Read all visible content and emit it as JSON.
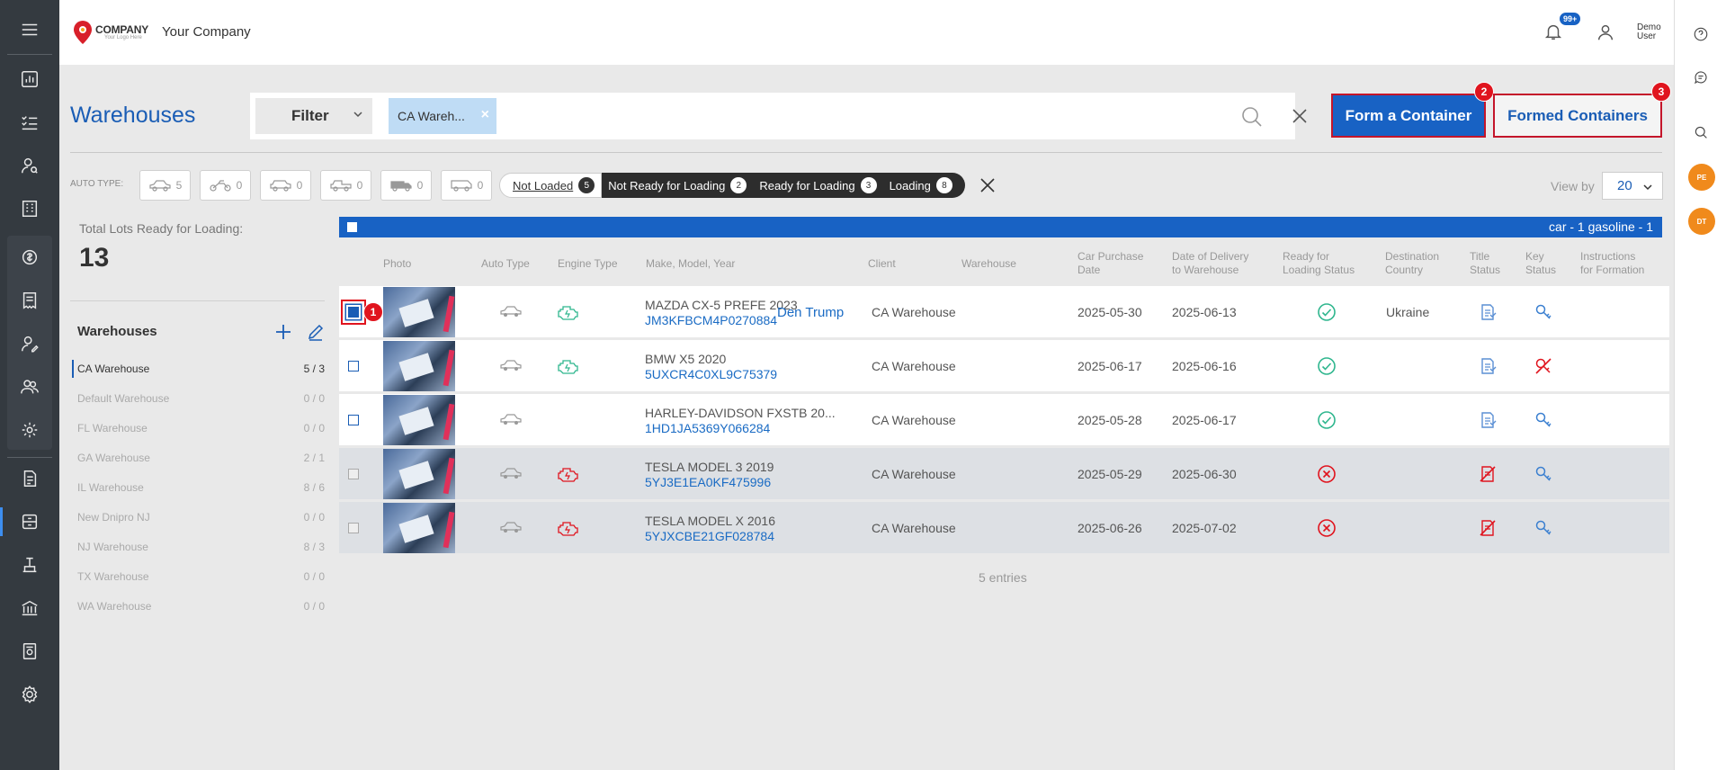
{
  "header": {
    "logo_text": "COMPANY",
    "logo_tagline": "Your Logo Here",
    "company_name": "Your Company",
    "notifications_badge": "99+",
    "user_first": "Demo",
    "user_last": "User"
  },
  "right_rail": {
    "avatars": [
      "PE",
      "DT"
    ]
  },
  "page": {
    "title": "Warehouses"
  },
  "filter": {
    "label": "Filter",
    "chip_label": "CA Wareh...",
    "chip_remove": "×"
  },
  "actions": {
    "form_container": "Form a Container",
    "form_container_badge": "2",
    "formed_containers": "Formed Containers",
    "formed_containers_badge": "3"
  },
  "auto_type": {
    "label": "AUTO TYPE:",
    "counts": [
      "5",
      "0",
      "0",
      "0",
      "0",
      "0"
    ]
  },
  "status_filters": [
    {
      "label": "Not Loaded",
      "count": "5"
    },
    {
      "label": "Not Ready for Loading",
      "count": "2"
    },
    {
      "label": "Ready for Loading",
      "count": "3"
    },
    {
      "label": "Loading",
      "count": "8"
    }
  ],
  "view_by": {
    "label": "View by",
    "value": "20"
  },
  "summary": {
    "total_label": "Total Lots Ready for Loading:",
    "total_value": "13"
  },
  "warehouses_panel": {
    "title": "Warehouses",
    "items": [
      {
        "name": "CA Warehouse",
        "count": "5 / 3",
        "active": true
      },
      {
        "name": "Default Warehouse",
        "count": "0 / 0"
      },
      {
        "name": "FL Warehouse",
        "count": "0 / 0"
      },
      {
        "name": "GA Warehouse",
        "count": "2 / 1"
      },
      {
        "name": "IL Warehouse",
        "count": "8 / 6"
      },
      {
        "name": "New Dnipro NJ",
        "count": "0 / 0"
      },
      {
        "name": "NJ Warehouse",
        "count": "8 / 3"
      },
      {
        "name": "TX Warehouse",
        "count": "0 / 0"
      },
      {
        "name": "WA Warehouse",
        "count": "0 / 0"
      }
    ]
  },
  "table": {
    "bar_summary": "car - 1 gasoline - 1",
    "headers": {
      "photo": "Photo",
      "auto_type": "Auto Type",
      "engine_type": "Engine Type",
      "make_model_year": "Make, Model, Year",
      "client": "Client",
      "warehouse": "Warehouse",
      "purchase_date_1": "Car Purchase",
      "purchase_date_2": "Date",
      "delivery_1": "Date of Delivery",
      "delivery_2": "to Warehouse",
      "ready_1": "Ready for",
      "ready_2": "Loading Status",
      "dest_1": "Destination",
      "dest_2": "Country",
      "title_1": "Title",
      "title_2": "Status",
      "key_1": "Key",
      "key_2": "Status",
      "instr_1": "Instructions",
      "instr_2": "for Formation"
    },
    "rows": [
      {
        "make": "MAZDA CX-5 PREFE 2023",
        "vin": "JM3KFBCM4P0270884",
        "client": "Den Trump",
        "warehouse": "CA Warehouse",
        "purchase": "2025-05-30",
        "delivery": "2025-06-13",
        "ready": true,
        "country": "Ukraine",
        "engine": "ok",
        "title_ok": true,
        "key_ok": true,
        "checked": true,
        "marker": "1"
      },
      {
        "make": "BMW X5 2020",
        "vin": "5UXCR4C0XL9C75379",
        "client": "",
        "warehouse": "CA Warehouse",
        "purchase": "2025-06-17",
        "delivery": "2025-06-16",
        "ready": true,
        "country": "",
        "engine": "ok",
        "title_ok": true,
        "key_ok": false
      },
      {
        "make": "HARLEY-DAVIDSON FXSTB 20...",
        "vin": "1HD1JA5369Y066284",
        "client": "",
        "warehouse": "CA Warehouse",
        "purchase": "2025-05-28",
        "delivery": "2025-06-17",
        "ready": true,
        "country": "",
        "engine": "none",
        "title_ok": true,
        "key_ok": true
      },
      {
        "make": "TESLA MODEL 3 2019",
        "vin": "5YJ3E1EA0KF475996",
        "client": "",
        "warehouse": "CA Warehouse",
        "purchase": "2025-05-29",
        "delivery": "2025-06-30",
        "ready": false,
        "country": "",
        "engine": "bad",
        "title_ok": false,
        "key_ok": true
      },
      {
        "make": "TESLA MODEL X 2016",
        "vin": "5YJXCBE21GF028784",
        "client": "",
        "warehouse": "CA Warehouse",
        "purchase": "2025-06-26",
        "delivery": "2025-07-02",
        "ready": false,
        "country": "",
        "engine": "bad",
        "title_ok": false,
        "key_ok": true
      }
    ],
    "entries": "5 entries"
  },
  "colors": {
    "brand_blue": "#1862c4",
    "nav_dark": "#343a40",
    "alert_red": "#e0141e",
    "ok_green": "#2fb68e",
    "avatar_orange": "#f08a1c"
  }
}
